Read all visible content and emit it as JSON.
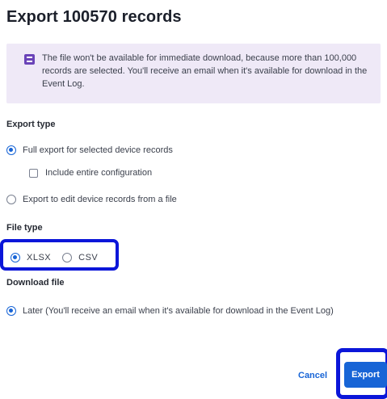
{
  "dialog": {
    "title": "Export 100570 records",
    "notice": {
      "icon": "info-icon",
      "text": "The file won't be available for immediate download, because more than 100,000 records are selected. You'll receive an email when it's available for download in the Event Log."
    },
    "export_type": {
      "label": "Export type",
      "options": [
        {
          "label": "Full export for selected device records",
          "selected": true
        },
        {
          "label": "Export to edit device records from a file",
          "selected": false
        }
      ],
      "include_config": {
        "label": "Include entire configuration",
        "checked": false
      }
    },
    "file_type": {
      "label": "File type",
      "options": [
        {
          "label": "XLSX",
          "selected": true
        },
        {
          "label": "CSV",
          "selected": false
        }
      ]
    },
    "download_file": {
      "label": "Download file",
      "options": [
        {
          "label": "Later (You'll receive an email when it's available for download in the Event Log)",
          "selected": true
        }
      ]
    },
    "actions": {
      "cancel_label": "Cancel",
      "export_label": "Export"
    },
    "colors": {
      "accent": "#1764d6",
      "notice_bg": "#efe9f7",
      "notice_icon": "#6a43b8",
      "highlight_box": "#0b16d9"
    }
  }
}
